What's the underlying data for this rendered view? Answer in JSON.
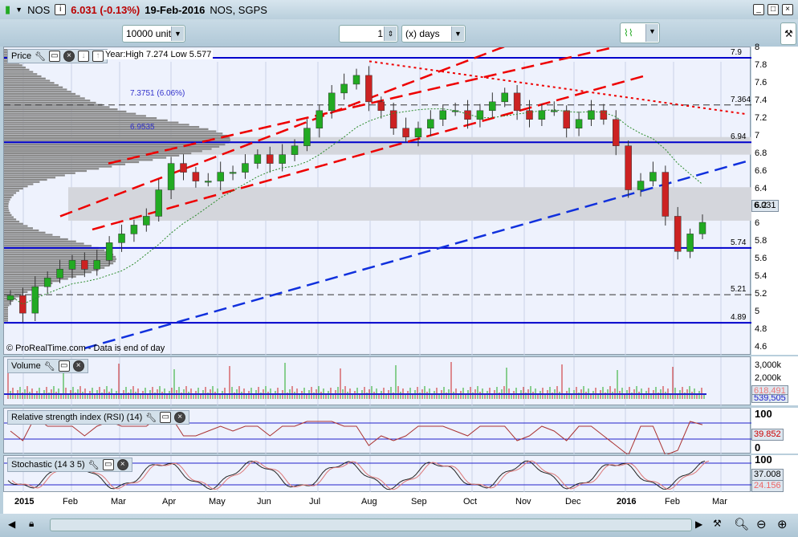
{
  "header": {
    "symbol": "NOS",
    "price_change": "6.031 (-0.13%)",
    "date": "19-Feb-2016",
    "name": "NOS, SGPS"
  },
  "toolbar": {
    "units": "10000 units",
    "period_value": "1",
    "period_unit": "(x) days"
  },
  "price_pane": {
    "label": "Price",
    "year_info": "Year:High 7.274 Low 5.577",
    "copyright": "© ProRealTime.com - Data is end of day",
    "current": "6.031",
    "levels": [
      {
        "value": 7.9,
        "label": "7.9"
      },
      {
        "value": 7.364,
        "label": "7.364"
      },
      {
        "value": 6.94,
        "label": "6.94"
      },
      {
        "value": 5.74,
        "label": "5.74"
      },
      {
        "value": 5.21,
        "label": "5.21"
      },
      {
        "value": 4.89,
        "label": "4.89"
      }
    ],
    "fib_labels": [
      "7.3751 (6.06%)",
      "6.9535"
    ],
    "ticks": [
      "8",
      "7.8",
      "7.6",
      "7.4",
      "7.2",
      "7",
      "6.8",
      "6.6",
      "6.4",
      "6.2",
      "6",
      "5.8",
      "5.6",
      "5.4",
      "5.2",
      "5",
      "4.8",
      "4.6"
    ]
  },
  "volume_pane": {
    "label": "Volume",
    "ticks": [
      "3,000k",
      "2,000k"
    ],
    "value1": "618,491",
    "value2": "539,505"
  },
  "rsi_pane": {
    "label": "Relative strength index (RSI) (14)",
    "ticks": [
      "100",
      "0"
    ],
    "value": "39.852"
  },
  "stoch_pane": {
    "label": "Stochastic (14 3 5)",
    "ticks": [
      "100"
    ],
    "value1": "37.008",
    "value2": "24.156"
  },
  "x_axis": [
    "2015",
    "Feb",
    "Mar",
    "Apr",
    "May",
    "Jun",
    "Jul",
    "Aug",
    "Sep",
    "Oct",
    "Nov",
    "Dec",
    "2016",
    "Feb",
    "Mar"
  ],
  "colors": {
    "up": "#22aa22",
    "down": "#cc2222",
    "level": "#0000cc",
    "trend_red": "#ee0000",
    "trend_blue": "#1030dd"
  },
  "chart_data": {
    "type": "candlestick",
    "title": "NOS",
    "x_unit": "week",
    "ylim": [
      4.6,
      8
    ],
    "closes": [
      5.2,
      5.0,
      5.3,
      5.4,
      5.5,
      5.6,
      5.5,
      5.6,
      5.8,
      5.9,
      6.0,
      6.1,
      6.4,
      6.7,
      6.6,
      6.5,
      6.5,
      6.6,
      6.6,
      6.7,
      6.8,
      6.7,
      6.8,
      6.9,
      7.1,
      7.3,
      7.5,
      7.6,
      7.7,
      7.4,
      7.3,
      7.1,
      7.0,
      7.1,
      7.2,
      7.3,
      7.3,
      7.2,
      7.3,
      7.4,
      7.5,
      7.3,
      7.2,
      7.3,
      7.3,
      7.1,
      7.2,
      7.3,
      7.2,
      6.9,
      6.4,
      6.5,
      6.6,
      6.1,
      5.7,
      5.9,
      6.031
    ]
  }
}
